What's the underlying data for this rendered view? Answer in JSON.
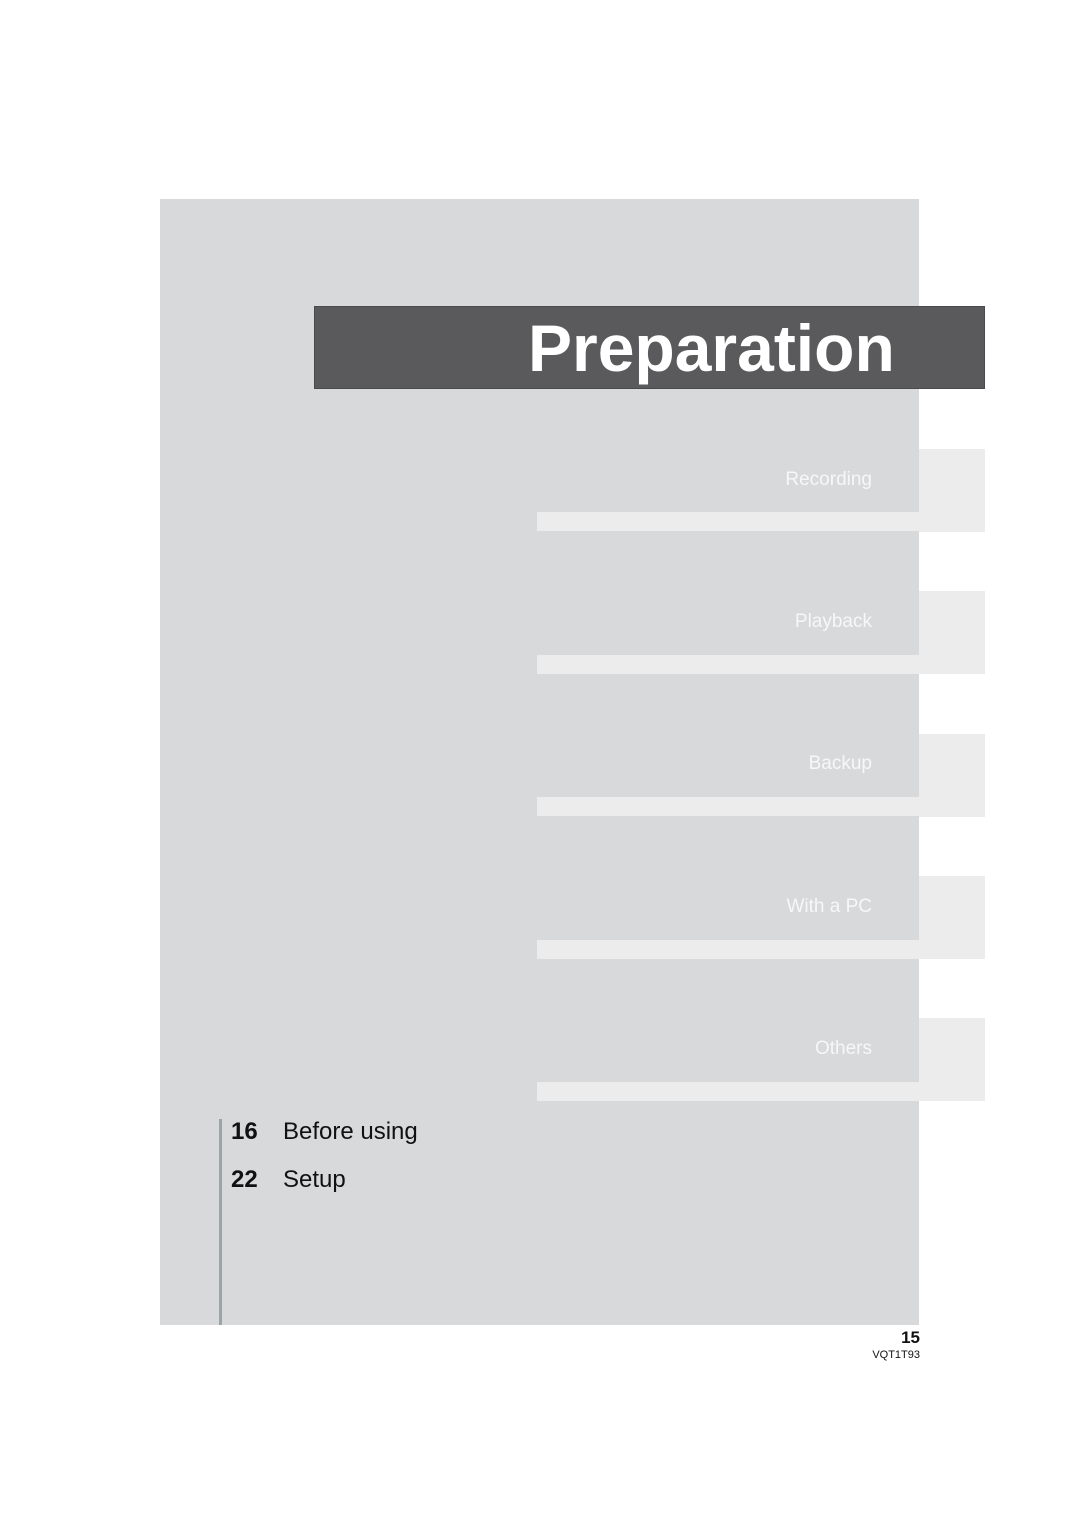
{
  "chapter_title": "Preparation",
  "section_tabs": [
    {
      "label": "Recording"
    },
    {
      "label": "Playback"
    },
    {
      "label": "Backup"
    },
    {
      "label": "With a PC"
    },
    {
      "label": "Others"
    }
  ],
  "toc": [
    {
      "page": "16",
      "title": "Before using"
    },
    {
      "page": "22",
      "title": "Setup"
    }
  ],
  "footer": {
    "page_number": "15",
    "document_code": "VQT1T93"
  }
}
